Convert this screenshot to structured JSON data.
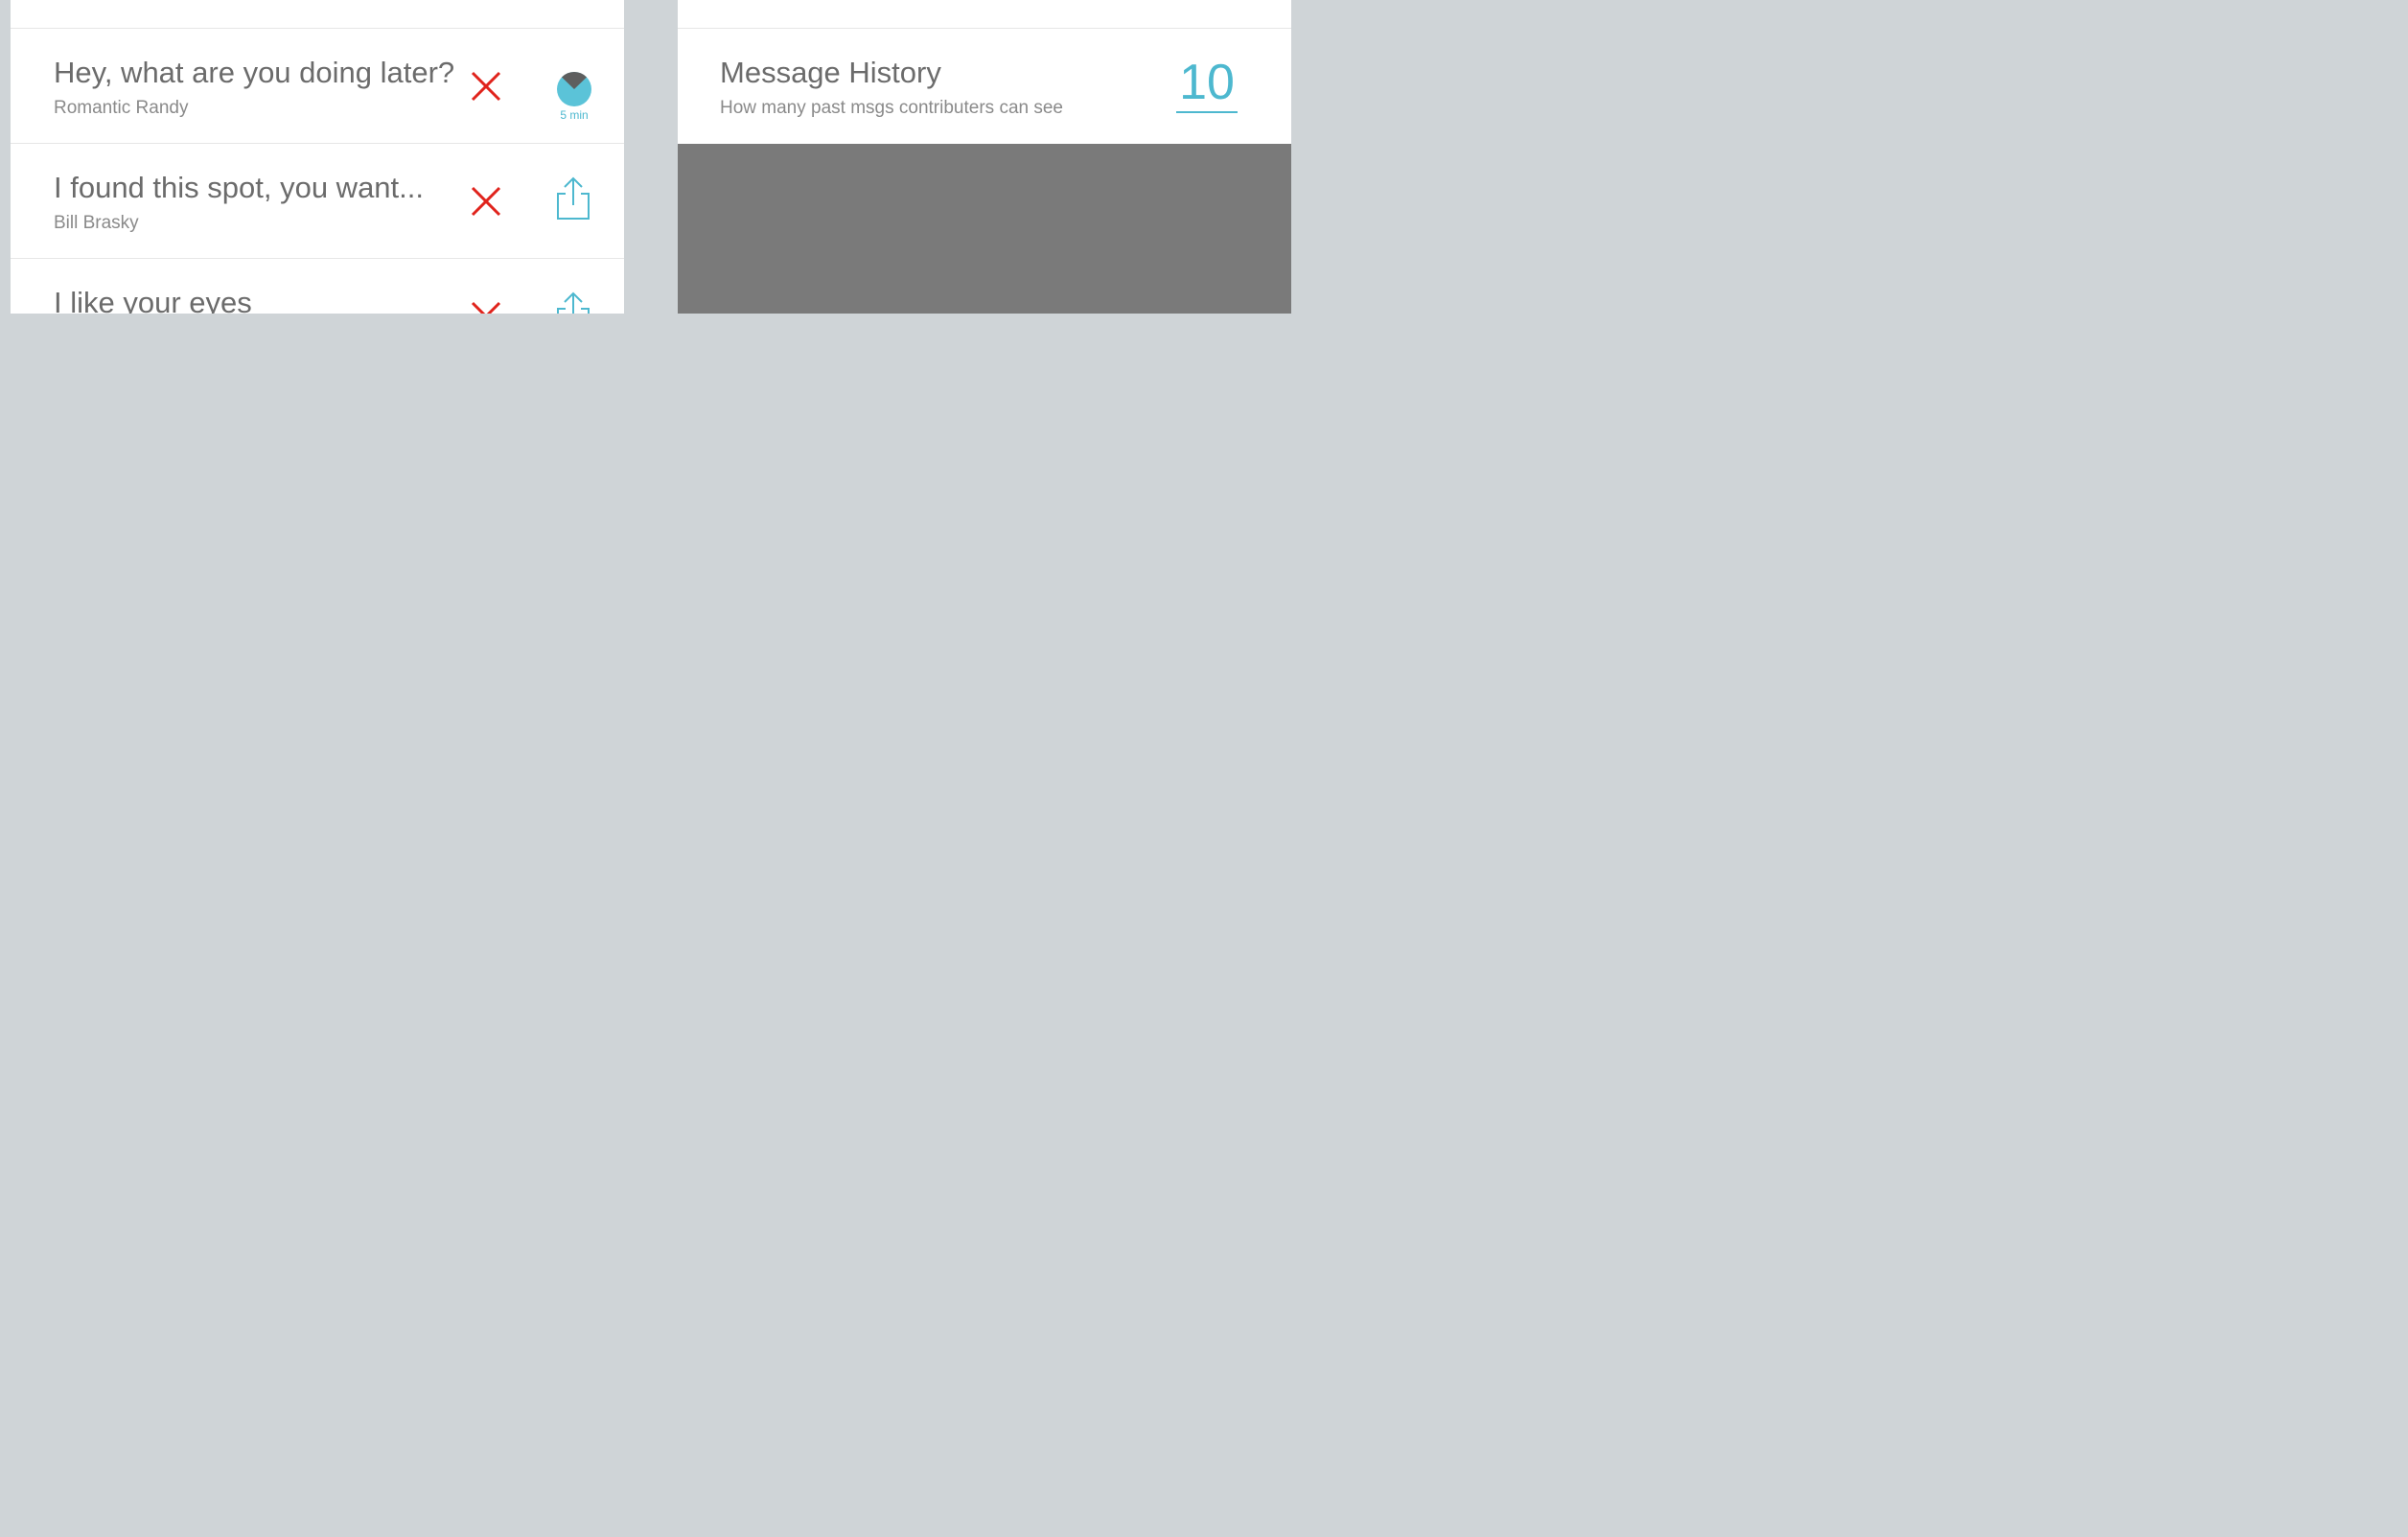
{
  "colors": {
    "background": "#cfd4d7",
    "panel": "#ffffff",
    "accent": "#4db8cf",
    "delete": "#e0231c",
    "text_primary": "#6b6b6b",
    "text_secondary": "#8a8a8a",
    "overlay": "#7a7a7a"
  },
  "messages": [
    {
      "title": "Hey, what are you doing later?",
      "sender": "Romantic Randy",
      "delete_icon": "close-icon",
      "action_icon": "timer-icon",
      "timer_label": "5 min"
    },
    {
      "title": "I found this spot, you want...",
      "sender": "Bill Brasky",
      "delete_icon": "close-icon",
      "action_icon": "share-icon"
    },
    {
      "title": "I like your eyes",
      "delete_icon": "close-icon",
      "action_icon": "share-icon"
    }
  ],
  "settings": {
    "message_history": {
      "title": "Message History",
      "description": "How many past msgs contributers can see",
      "value": "10"
    }
  }
}
